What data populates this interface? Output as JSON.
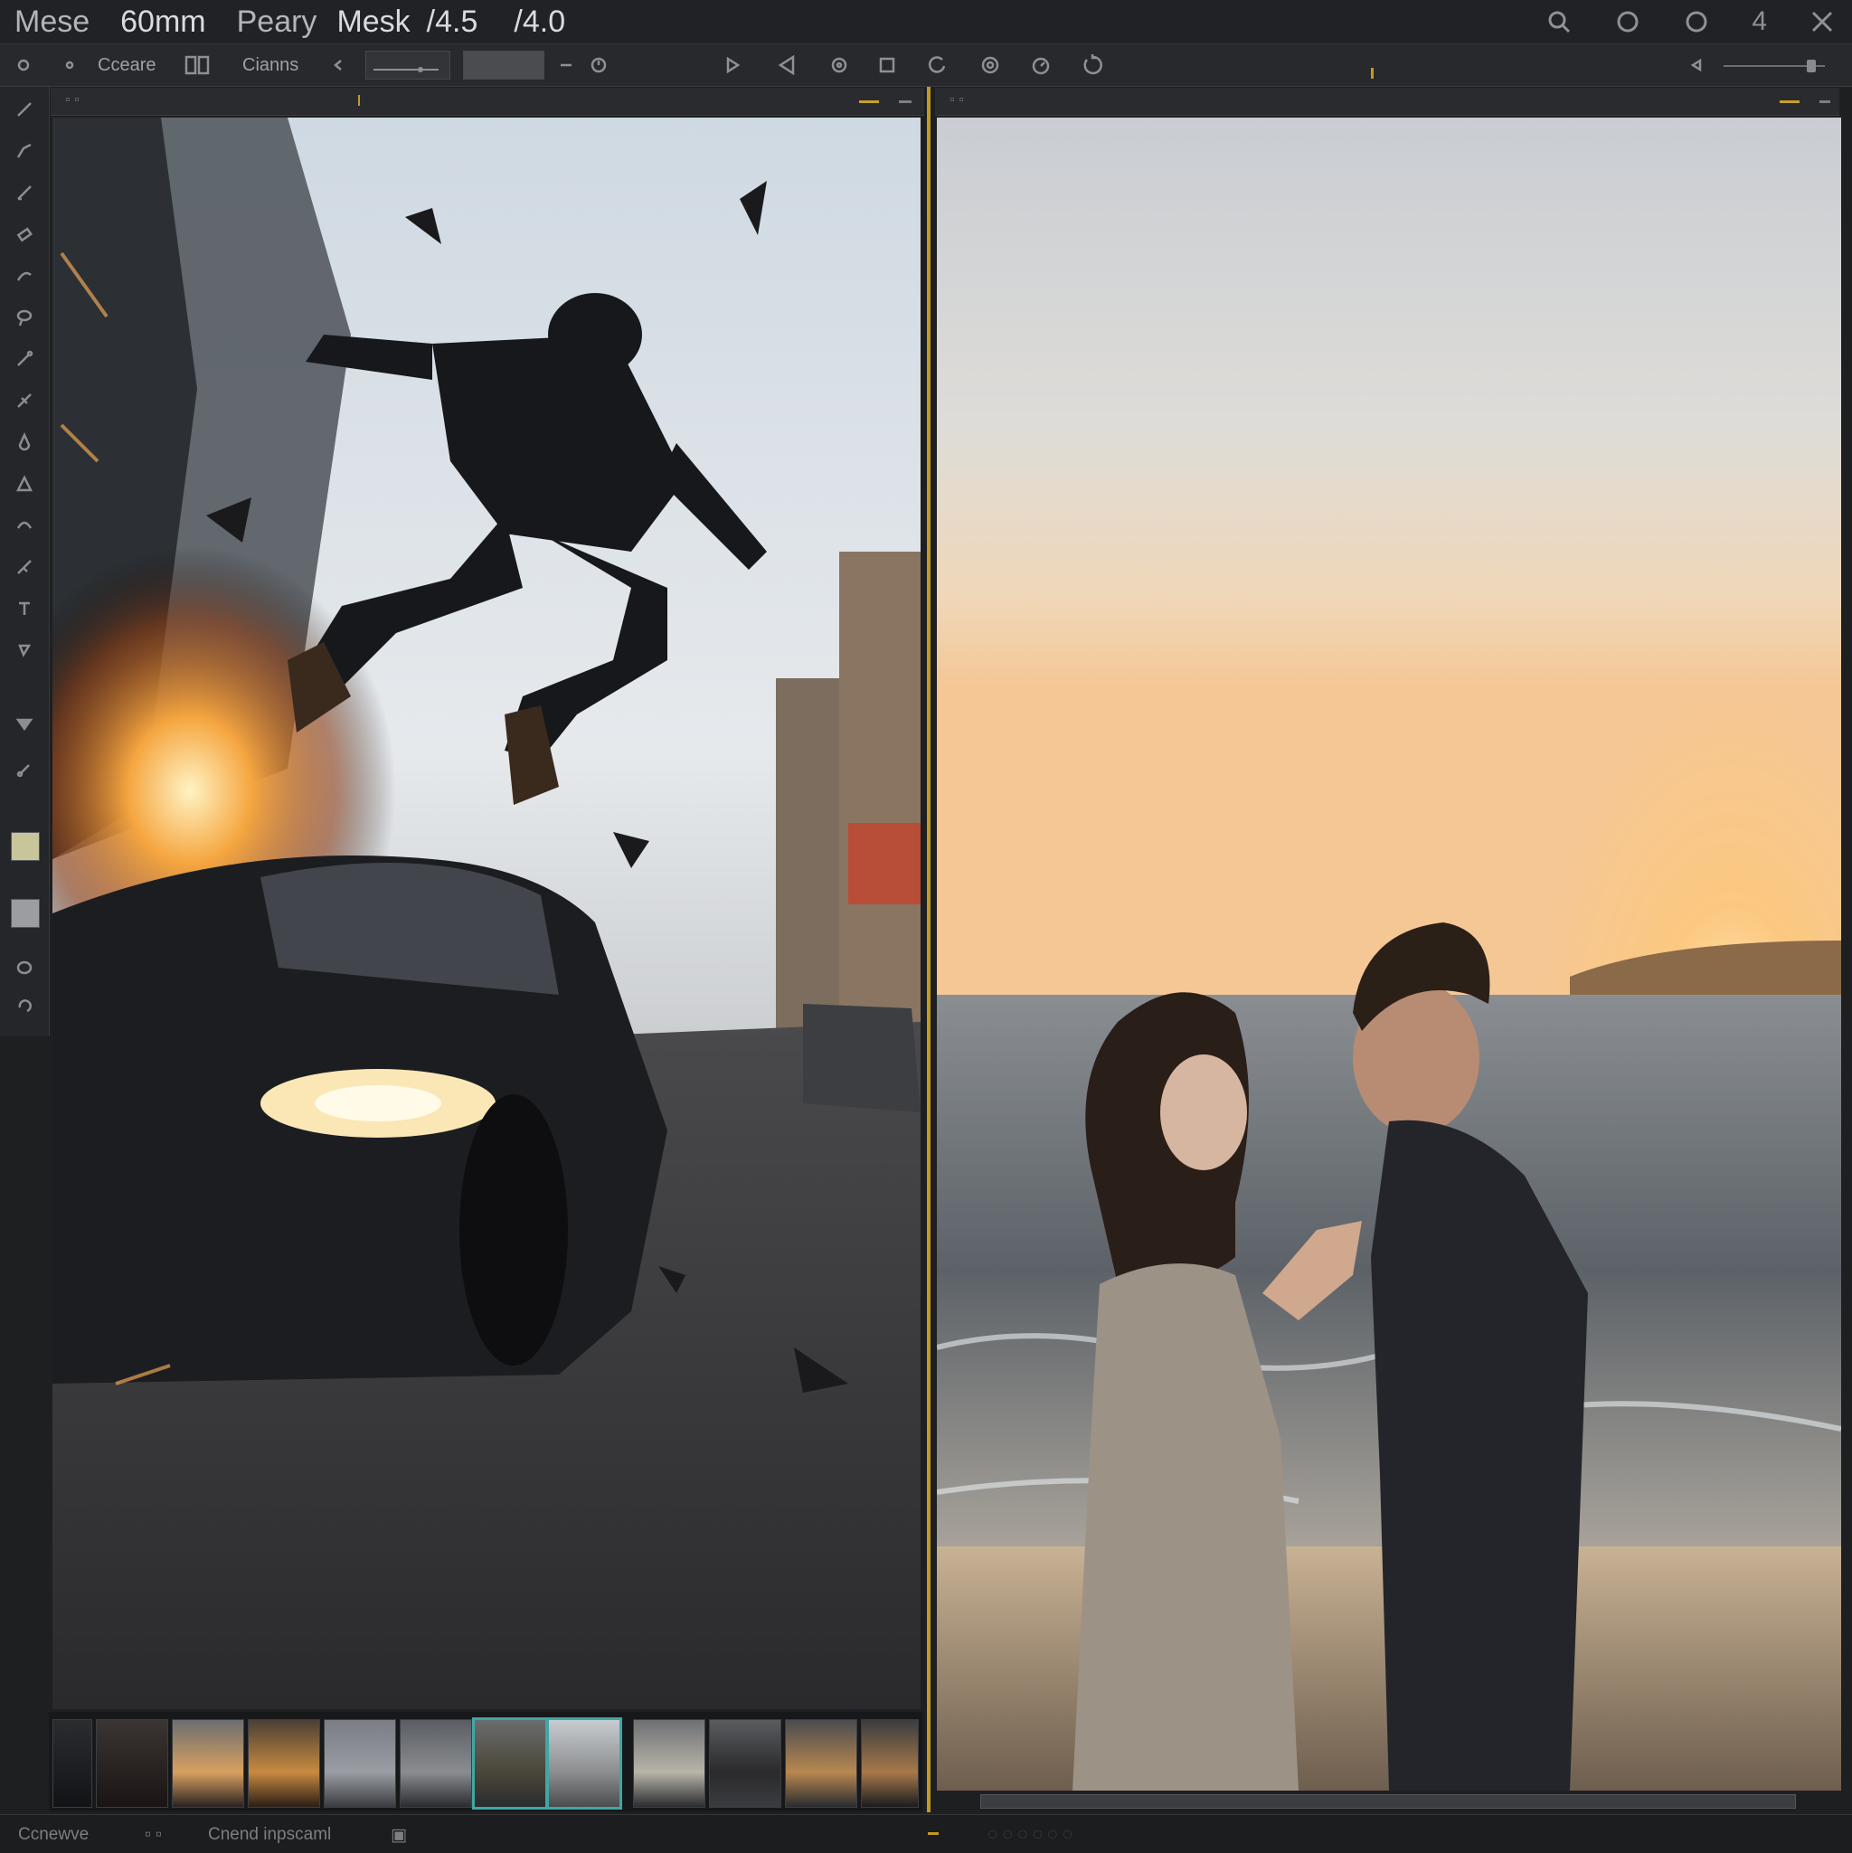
{
  "titlebar": {
    "app": "Mese",
    "lens": "60mm",
    "view": "Peary",
    "mode": "Mesk",
    "aperture_a": "/4.5",
    "aperture_b": "/4.0",
    "counter": "4"
  },
  "toolbar": {
    "item1": "Cceare",
    "item2": "Cianns"
  },
  "viewers": {
    "left_image": "action scene: man leaping over exploding car on city street",
    "right_image": "couple facing each other on beach at sunset"
  },
  "filmstrip": {
    "count": 12,
    "selected": [
      6,
      7
    ]
  },
  "statusbar": {
    "left": "Ccnewve",
    "middle": "Cnend inpscaml"
  },
  "colors": {
    "accent": "#c29a23",
    "selection": "#3fa7a4",
    "background": "#1e1f21"
  }
}
